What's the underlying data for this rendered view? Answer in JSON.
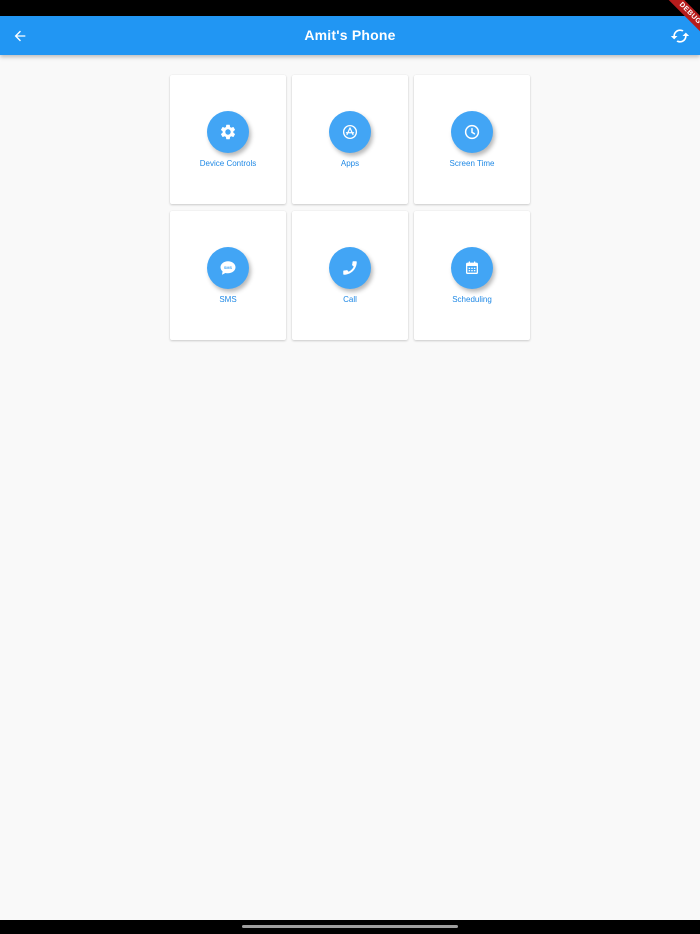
{
  "app_bar": {
    "title": "Amit's Phone",
    "back_icon": "arrow-back-icon",
    "refresh_icon": "refresh-icon",
    "color": "#2196f3"
  },
  "debug_banner": {
    "label": "DEBUG",
    "color": "#b71c1c"
  },
  "tiles": [
    {
      "label": "Device Controls",
      "icon": "gear-icon"
    },
    {
      "label": "Apps",
      "icon": "app-store-icon"
    },
    {
      "label": "Screen Time",
      "icon": "clock-icon"
    },
    {
      "label": "SMS",
      "icon": "sms-icon"
    },
    {
      "label": "Call",
      "icon": "phone-icon"
    },
    {
      "label": "Scheduling",
      "icon": "calendar-icon"
    }
  ],
  "colors": {
    "accent": "#2196f3",
    "icon_circle": "#42a5f5",
    "label": "#1e88e5",
    "background": "#f9f9f9"
  }
}
